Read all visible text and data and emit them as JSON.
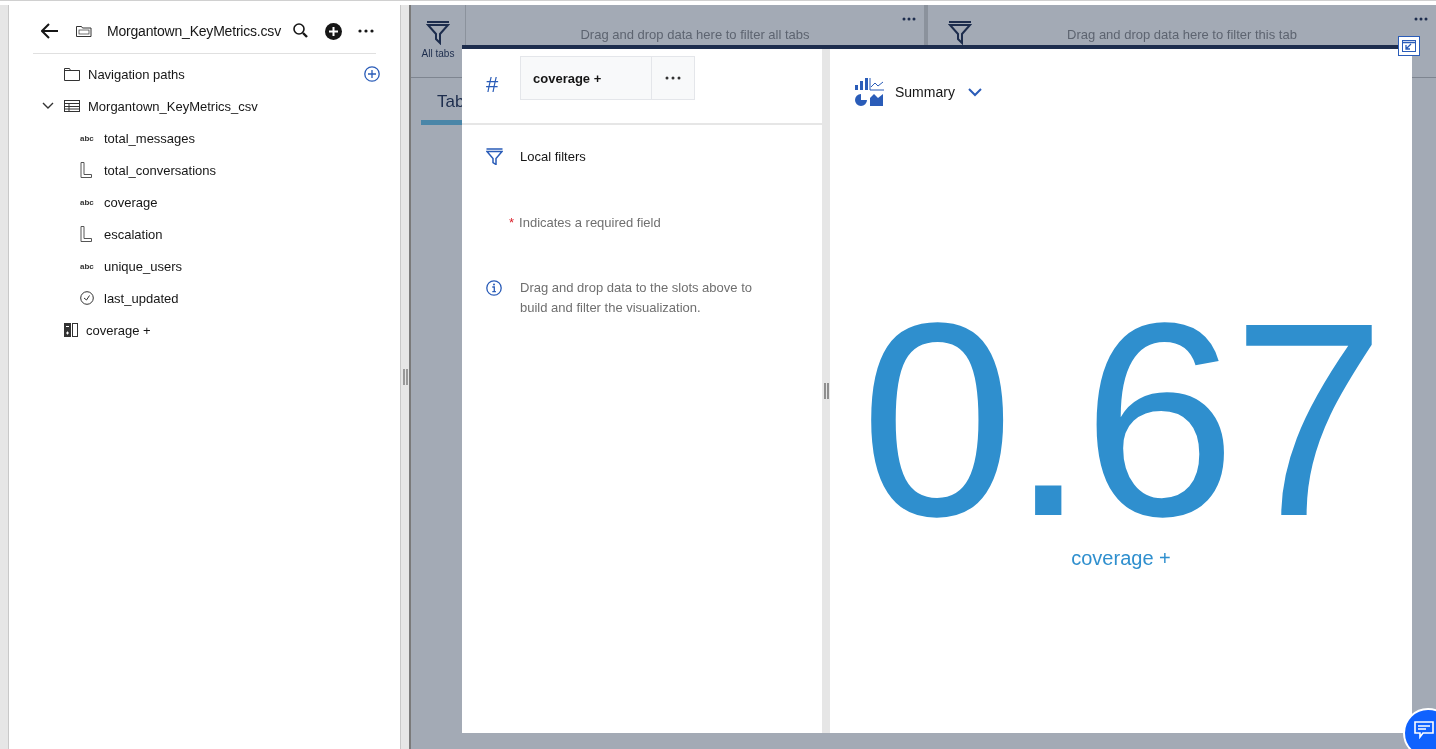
{
  "data_panel": {
    "title": "Morgantown_KeyMetrics.csv",
    "tree": [
      {
        "kind": "folder",
        "label": "Navigation paths"
      },
      {
        "kind": "table",
        "label": "Morgantown_KeyMetrics_csv",
        "expanded": true,
        "children": [
          {
            "kind": "text",
            "badge": "abc",
            "label": "total_messages"
          },
          {
            "kind": "measure",
            "label": "total_conversations"
          },
          {
            "kind": "text",
            "badge": "abc",
            "label": "coverage"
          },
          {
            "kind": "measure",
            "label": "escalation"
          },
          {
            "kind": "text",
            "badge": "abc",
            "label": "unique_users"
          },
          {
            "kind": "date",
            "label": "last_updated"
          }
        ]
      },
      {
        "kind": "calculation",
        "label": "coverage +"
      }
    ]
  },
  "dashboard": {
    "all_tabs_label": "All tabs",
    "filter_all_hint": "Drag and drop data here to filter all tabs",
    "tab_label": "Tab",
    "filter_tab_hint": "Drag and drop data here to filter this tab"
  },
  "editor": {
    "slot_symbol": "#",
    "slot_value": "coverage +",
    "local_filters": "Local filters",
    "required_mark": "*",
    "required_note": "Indicates a required field",
    "info_note": "Drag and drop data to the slots above to build and filter the visualization.",
    "viz_type": "Summary",
    "value": "0.67",
    "value_label": "coverage +"
  }
}
